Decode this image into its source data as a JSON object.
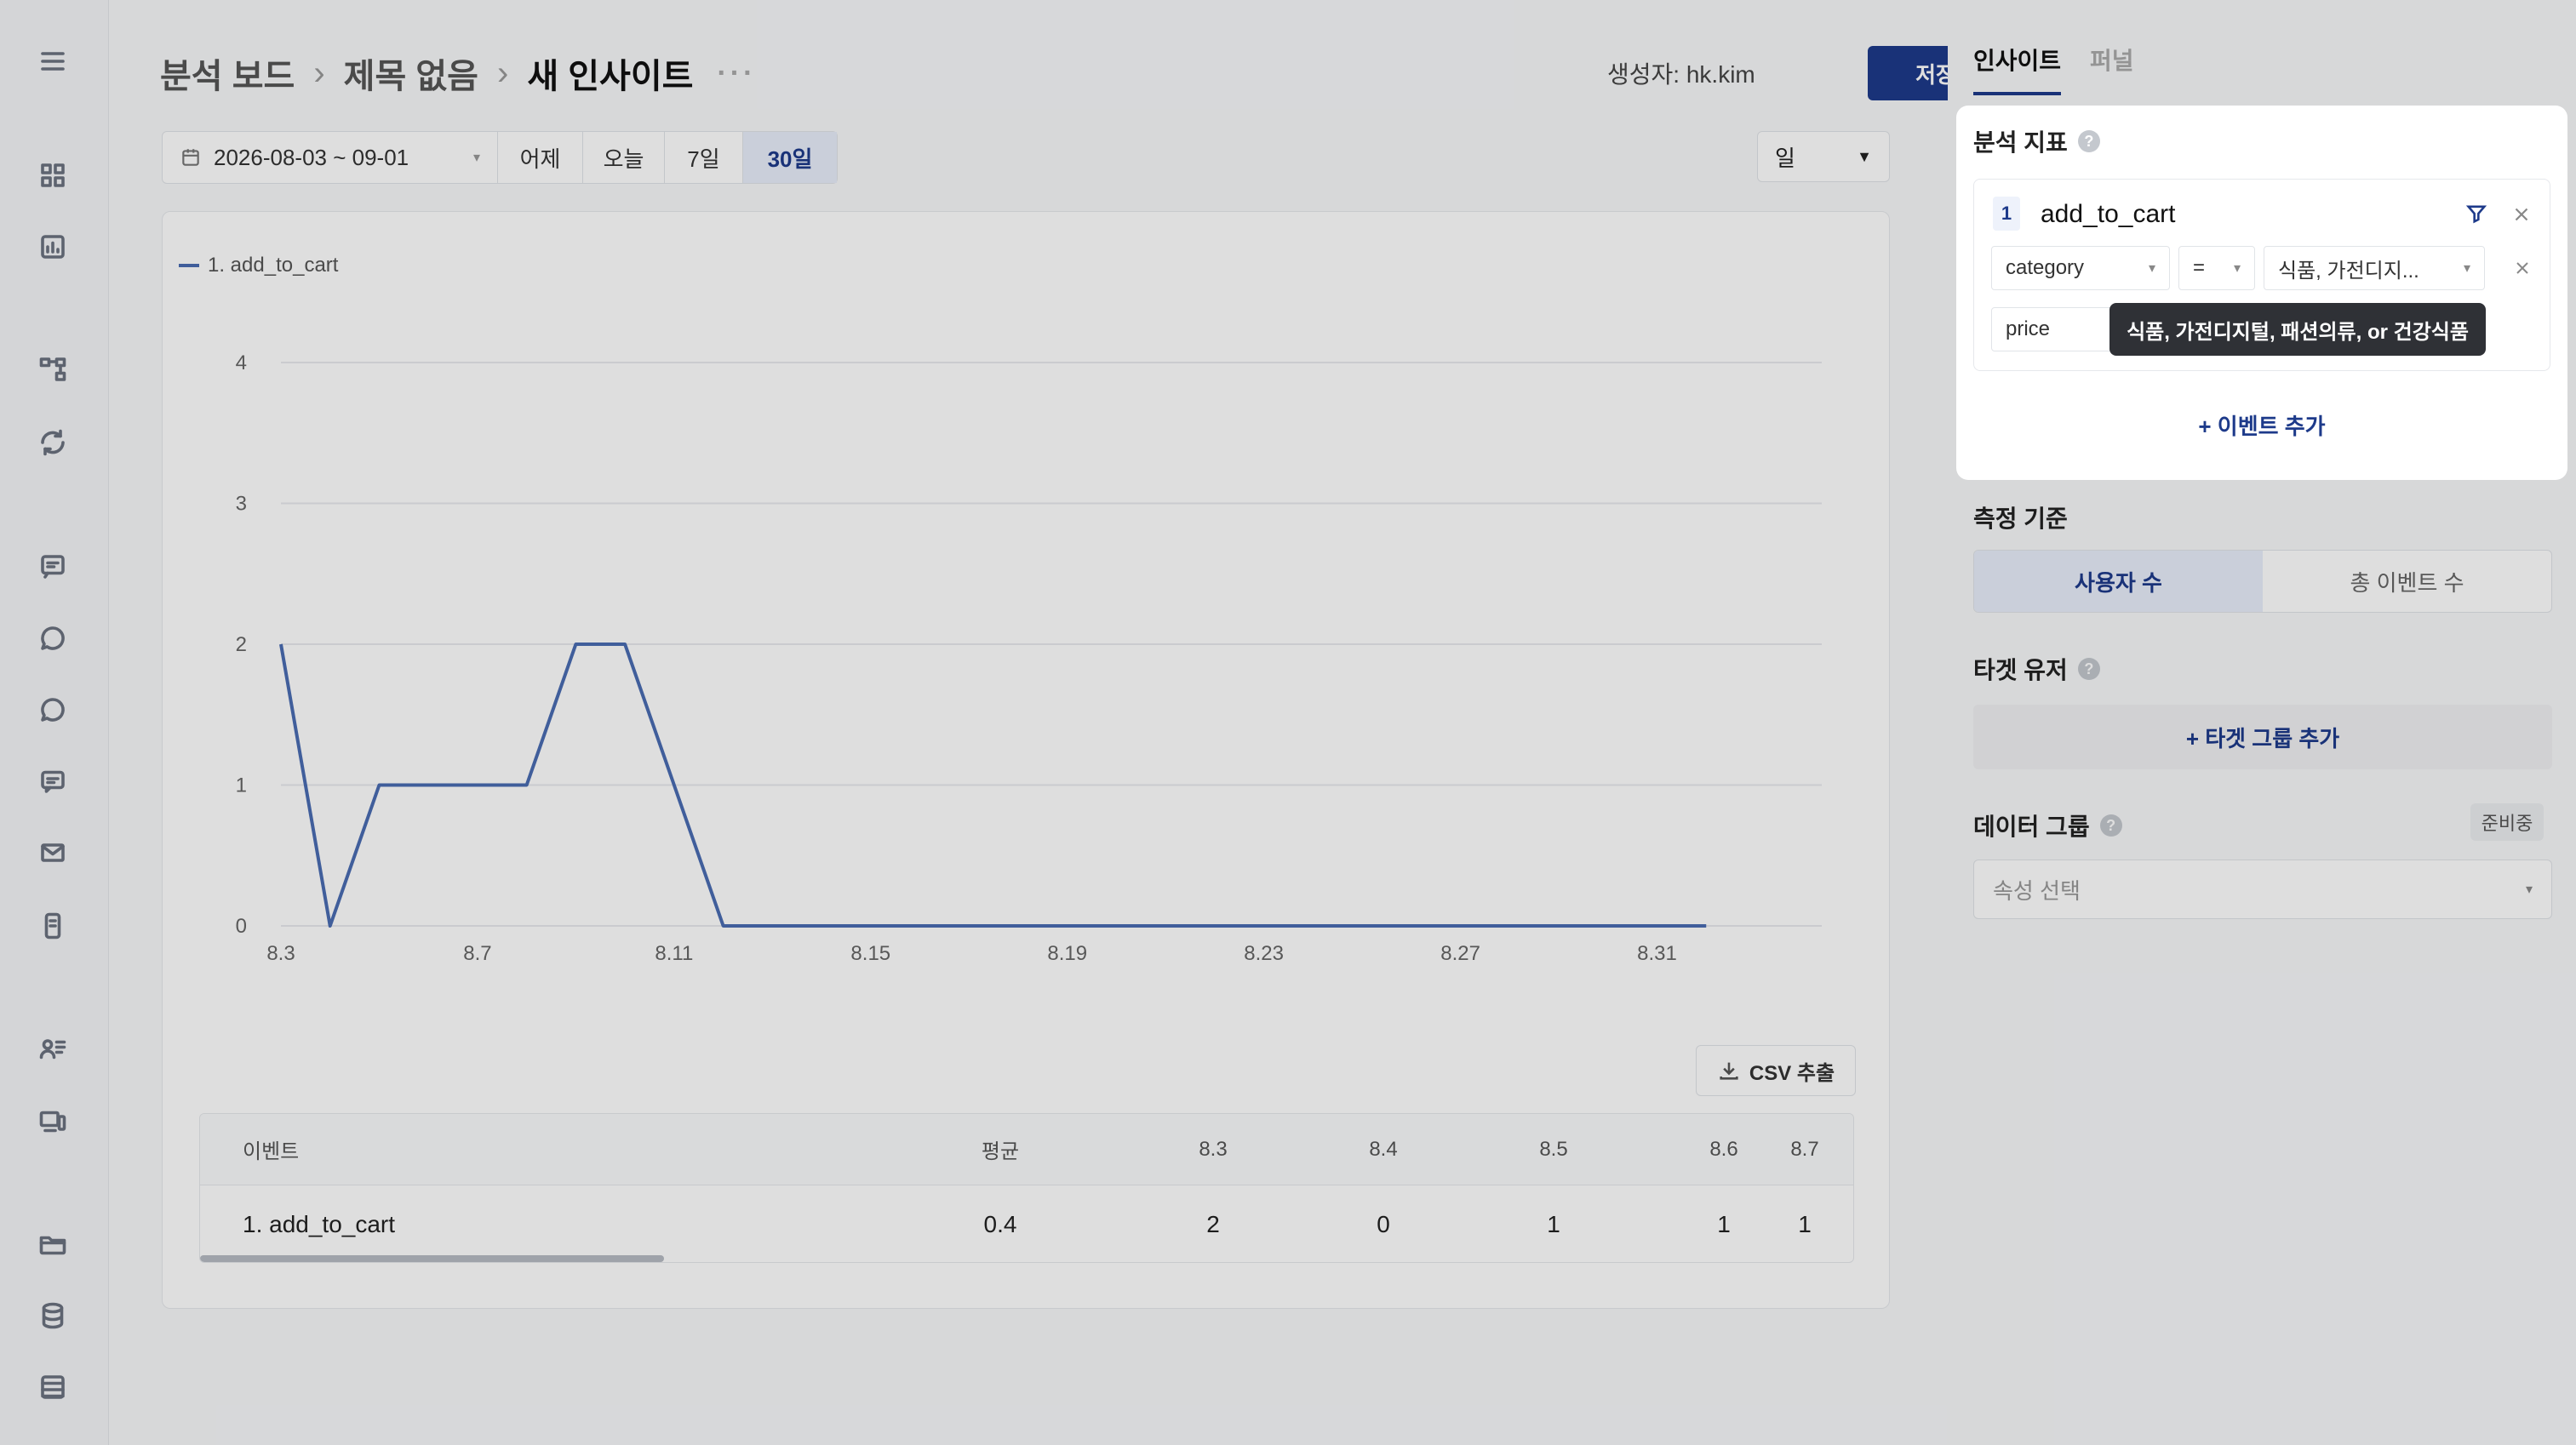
{
  "breadcrumb": {
    "items": [
      "분석 보드",
      "제목 없음",
      "새 인사이트"
    ],
    "more": "···"
  },
  "header": {
    "creator_label": "생성자:",
    "creator_name": "hk.kim",
    "save_label": "저장"
  },
  "date_range": {
    "value": "2026-08-03 ~ 09-01",
    "quick": [
      "어제",
      "오늘",
      "7일",
      "30일"
    ],
    "active": "30일"
  },
  "interval": {
    "value": "일"
  },
  "csv_export_label": "CSV 추출",
  "table": {
    "headers": [
      "이벤트",
      "평균",
      "8.3",
      "8.4",
      "8.5",
      "8.6",
      "8.7"
    ],
    "rows": [
      [
        "1. add_to_cart",
        "0.4",
        "2",
        "0",
        "1",
        "1",
        "1"
      ]
    ]
  },
  "right_panel": {
    "tabs": [
      "인사이트",
      "퍼널"
    ],
    "active_tab": "인사이트",
    "metric_title": "분석 지표",
    "event": {
      "index": "1",
      "name": "add_to_cart"
    },
    "filters": [
      {
        "property": "category",
        "operator": "=",
        "value": "식품, 가전디지..."
      },
      {
        "property": "price"
      }
    ],
    "tooltip": "식품, 가전디지털, 패션의류, or 건강식품",
    "add_event_label": "+ 이벤트 추가",
    "measure_title": "측정 기준",
    "measure_options": [
      "사용자 수",
      "총 이벤트 수"
    ],
    "measure_active": "사용자 수",
    "target_title": "타겟 유저",
    "add_target_label": "+ 타겟 그룹 추가",
    "datagroup_title": "데이터 그룹",
    "datagroup_badge": "준비중",
    "attribute_placeholder": "속성 선택"
  },
  "chart_data": {
    "type": "line",
    "series": [
      {
        "name": "1. add_to_cart",
        "color": "#4a6cb3",
        "values": [
          2,
          0,
          1,
          1,
          1,
          1,
          2,
          2,
          1,
          0,
          0,
          0,
          0,
          0,
          0,
          0,
          0,
          0,
          0,
          0,
          0,
          0,
          0,
          0,
          0,
          0,
          0,
          0,
          0,
          0
        ]
      }
    ],
    "x": [
      "8.3",
      "8.4",
      "8.5",
      "8.6",
      "8.7",
      "8.8",
      "8.9",
      "8.10",
      "8.11",
      "8.12",
      "8.13",
      "8.14",
      "8.15",
      "8.16",
      "8.17",
      "8.18",
      "8.19",
      "8.20",
      "8.21",
      "8.22",
      "8.23",
      "8.24",
      "8.25",
      "8.26",
      "8.27",
      "8.28",
      "8.29",
      "8.30",
      "8.31",
      "9.1"
    ],
    "x_tick_labels": [
      "8.3",
      "8.7",
      "8.11",
      "8.15",
      "8.19",
      "8.23",
      "8.27",
      "8.31"
    ],
    "y_ticks": [
      0,
      1,
      2,
      3,
      4
    ],
    "ylim": [
      0,
      4
    ],
    "grid": true,
    "legend": "top-left"
  }
}
